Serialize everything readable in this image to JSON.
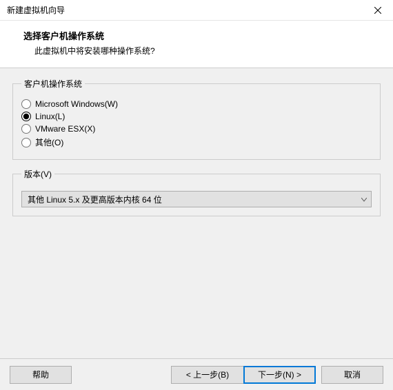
{
  "titlebar": {
    "title": "新建虚拟机向导"
  },
  "header": {
    "title": "选择客户机操作系统",
    "subtitle": "此虚拟机中将安装哪种操作系统?"
  },
  "os_group": {
    "legend": "客户机操作系统",
    "options": [
      {
        "label": "Microsoft Windows(W)",
        "selected": false
      },
      {
        "label": "Linux(L)",
        "selected": true
      },
      {
        "label": "VMware ESX(X)",
        "selected": false
      },
      {
        "label": "其他(O)",
        "selected": false
      }
    ]
  },
  "version_group": {
    "legend": "版本(V)",
    "selected": "其他 Linux 5.x 及更高版本内核 64 位"
  },
  "footer": {
    "help": "帮助",
    "back": "< 上一步(B)",
    "next": "下一步(N) >",
    "cancel": "取消"
  }
}
